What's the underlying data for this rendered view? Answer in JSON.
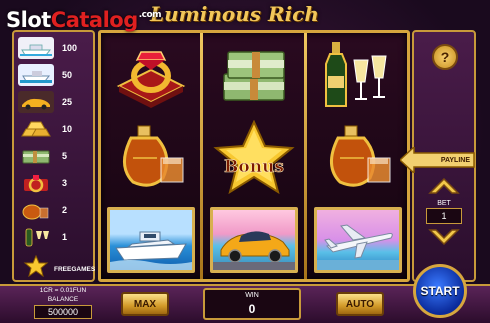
{
  "logo": {
    "slot": "Slot",
    "catalog": "Catalog",
    "dotcom": ".com"
  },
  "game": {
    "title": "Luminous Rich"
  },
  "paytable": [
    {
      "symbol": "bonus-star",
      "value": "100"
    },
    {
      "symbol": "yacht",
      "value": "50"
    },
    {
      "symbol": "sports-car",
      "value": "25"
    },
    {
      "symbol": "gold-bars",
      "value": "10"
    },
    {
      "symbol": "money-stack",
      "value": "5"
    },
    {
      "symbol": "ring",
      "value": "3"
    },
    {
      "symbol": "cognac",
      "value": "2"
    },
    {
      "symbol": "champagne",
      "value": "1"
    },
    {
      "symbol": "bonus-star",
      "value": "FREEGAMES"
    }
  ],
  "reels": [
    [
      "ring",
      "money-stack",
      "champagne"
    ],
    [
      "cognac",
      "bonus",
      "cognac"
    ],
    [
      "yacht",
      "sports-car",
      "airplane"
    ]
  ],
  "bonus_text": "Bonus",
  "controls": {
    "help": "?",
    "payline": "PAYLINE",
    "bet_label": "BET",
    "bet_value": "1",
    "denomination": "1CR = 0.01FUN",
    "balance_label": "BALANCE",
    "balance_value": "500000",
    "max": "MAX",
    "win_label": "WIN",
    "win_value": "0",
    "auto": "AUTO",
    "start": "START"
  },
  "colors": {
    "gold": "#d6a63e",
    "purple": "#4a1c4a",
    "start_blue": "#1a4ad0"
  }
}
